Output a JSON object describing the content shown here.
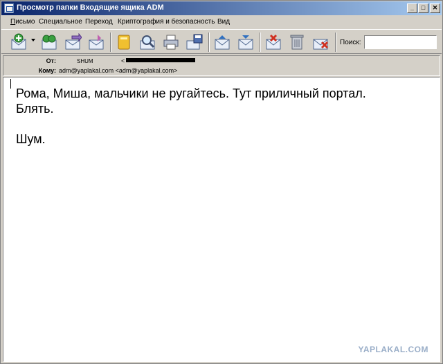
{
  "window": {
    "title": "Просмотр папки Входящие ящика ADM",
    "minimize": "_",
    "maximize": "□",
    "close": "✕"
  },
  "menu": [
    {
      "label": "Письмо",
      "underline": "П"
    },
    {
      "label": "Специальное",
      "underline": "С"
    },
    {
      "label": "Переход",
      "underline": "П"
    },
    {
      "label": "Криптография и безопасность",
      "underline": "К"
    },
    {
      "label": "Вид",
      "underline": "В"
    }
  ],
  "toolbar": {
    "search_label": "Поиск:",
    "search_value": ""
  },
  "header": {
    "from_label": "От:",
    "from_name": "SHUM",
    "from_email_open": "<",
    "to_label": "Кому:",
    "to_value": "adm@yaplakal.com <adm@yaplakal.com>"
  },
  "message": {
    "body": "Рома, Миша, мальчики не ругайтесь. Тут приличный портал.\nБлять.\n\nШум."
  },
  "watermark": "YAPLAKAL.COM"
}
